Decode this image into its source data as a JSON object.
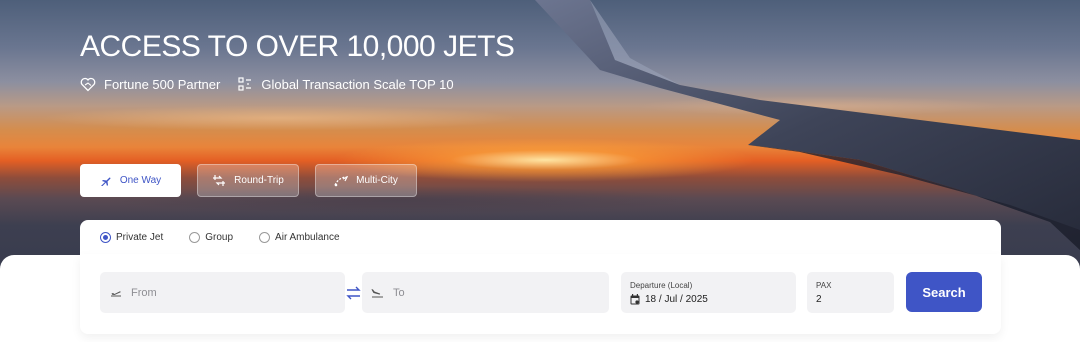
{
  "hero": {
    "headline": "ACCESS TO OVER 10,000 JETS",
    "badges": [
      {
        "icon": "heart-handshake-icon",
        "label": "Fortune 500 Partner"
      },
      {
        "icon": "ranking-icon",
        "label": "Global Transaction Scale TOP 10"
      }
    ]
  },
  "trip_tabs": [
    {
      "icon": "plane-icon",
      "label": "One Way",
      "active": true
    },
    {
      "icon": "round-trip-icon",
      "label": "Round-Trip",
      "active": false
    },
    {
      "icon": "multi-city-icon",
      "label": "Multi-City",
      "active": false
    }
  ],
  "service_types": [
    {
      "label": "Private Jet",
      "selected": true
    },
    {
      "label": "Group",
      "selected": false
    },
    {
      "label": "Air Ambulance",
      "selected": false
    }
  ],
  "search": {
    "from_placeholder": "From",
    "to_placeholder": "To",
    "departure_label": "Departure (Local)",
    "departure_value": "18 / Jul / 2025",
    "pax_label": "PAX",
    "pax_value": "2",
    "button_label": "Search"
  },
  "colors": {
    "accent": "#3f55c6",
    "field_bg": "#f2f2f4"
  }
}
